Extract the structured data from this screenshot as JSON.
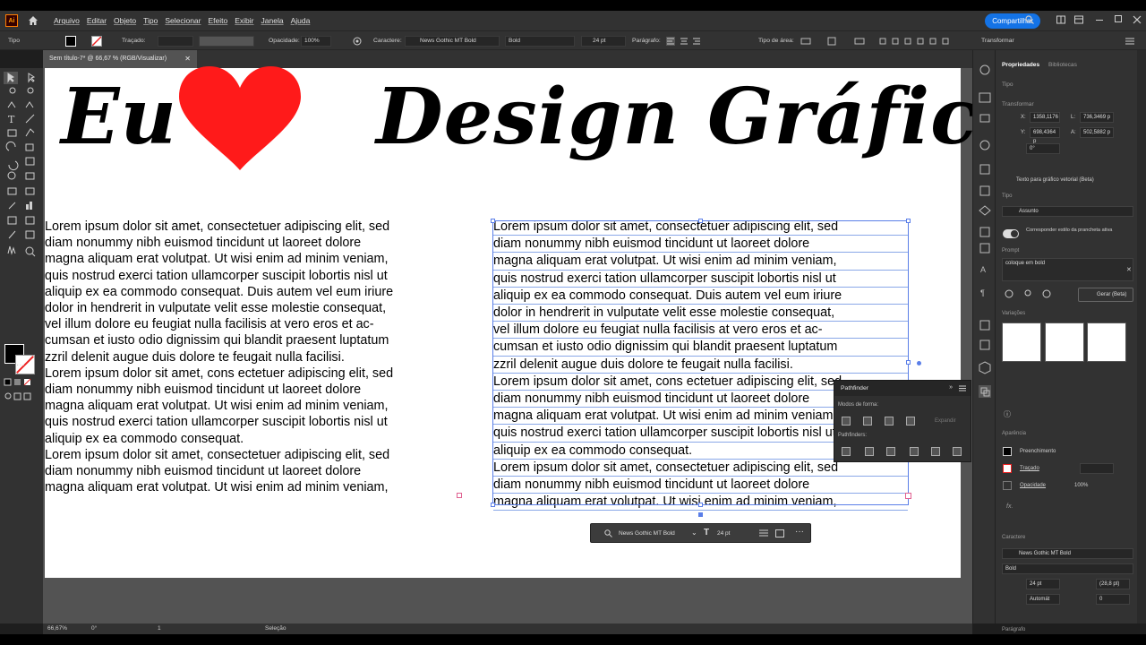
{
  "menubar": {
    "items": [
      "Arquivo",
      "Editar",
      "Objeto",
      "Tipo",
      "Selecionar",
      "Efeito",
      "Exibir",
      "Janela",
      "Ajuda"
    ],
    "share_label": "Compartilhar"
  },
  "control_bar": {
    "mode_label": "Tipo",
    "stroke_label": "Traçado:",
    "opacity_label": "Opacidade:",
    "opacity_value": "100%",
    "character_label": "Caractere:",
    "font_value": "News Gothic MT Bold",
    "style_value": "Bold",
    "size_value": "24 pt",
    "paragraph_label": "Parágrafo:",
    "area_type_label": "Tipo de área:",
    "transform_label": "Transformar"
  },
  "document": {
    "tab_title": "Sem título-7* @ 66,67 % (RGB/Visualizar)"
  },
  "artwork": {
    "title_left": "Eu",
    "title_right": "Design Gráfico",
    "heart_color": "#ff1a1a",
    "paragraphs": [
      [
        "Lorem ipsum dolor sit amet, consectetuer adipiscing elit, sed",
        "diam nonummy nibh euismod tincidunt ut laoreet dolore",
        "magna aliquam erat volutpat. Ut wisi enim ad minim veniam,",
        "quis nostrud exerci tation ullamcorper suscipit lobortis nisl ut",
        "aliquip ex ea commodo consequat. Duis autem vel eum iriure",
        "dolor in hendrerit in vulputate velit esse molestie consequat,",
        "vel illum dolore eu feugiat nulla facilisis at vero eros et ac-",
        "cumsan et iusto odio dignissim qui blandit praesent luptatum",
        "zzril delenit augue duis dolore te feugait nulla facilisi."
      ],
      [
        "Lorem ipsum dolor sit amet, cons ectetuer adipiscing elit, sed",
        "diam nonummy nibh euismod tincidunt ut laoreet dolore",
        "magna aliquam erat volutpat. Ut wisi enim ad minim veniam,",
        "quis nostrud exerci tation ullamcorper suscipit lobortis nisl ut",
        "aliquip ex ea commodo consequat."
      ],
      [
        "Lorem ipsum dolor sit amet, consectetuer adipiscing elit, sed",
        "diam nonummy nibh euismod tincidunt ut laoreet dolore",
        "magna aliquam erat volutpat. Ut wisi enim ad minim veniam,"
      ]
    ]
  },
  "pathfinder": {
    "title": "Pathfinder",
    "shape_modes_label": "Modos de forma:",
    "expand_label": "Expandir",
    "pathfinders_label": "Pathfinders:"
  },
  "context_bar": {
    "font": "News Gothic MT Bold",
    "size": "24 pt"
  },
  "properties": {
    "tab_properties": "Propriedades",
    "tab_libraries": "Bibliotecas",
    "section_type": "Tipo",
    "transform_label": "Transformar",
    "x_value": "1358,1176",
    "y_value": "698,4364 p",
    "w_value": "736,3469 p",
    "h_value": "502,5882 p",
    "angle_value": "0°",
    "vector_text_label": "Texto para gráfico vetorial (Beta)",
    "type_label": "Tipo",
    "subject_value": "Assunto",
    "match_style_label": "Corresponder estilo da prancheta ativa",
    "prompt_label": "Prompt",
    "prompt_value": "coloque em bold",
    "generate_label": "Gerar (Beta)",
    "variations_label": "Variações",
    "appearance_label": "Aparência",
    "fill_label": "Preenchimento",
    "stroke_label": "Traçado",
    "opacity_label": "Opacidade",
    "opacity_value": "100%",
    "fx_label": "fx.",
    "character_label": "Caractere",
    "font_value": "News Gothic MT Bold",
    "style_value": "Bold",
    "size_value": "24 pt",
    "leading_value": "(28,8 pt)",
    "kerning_value": "Automát",
    "tracking_value": "0",
    "paragraph_label": "Parágrafo"
  },
  "status": {
    "zoom": "66,67%",
    "rotation": "0°",
    "artboard": "1",
    "tool": "Seleção"
  }
}
